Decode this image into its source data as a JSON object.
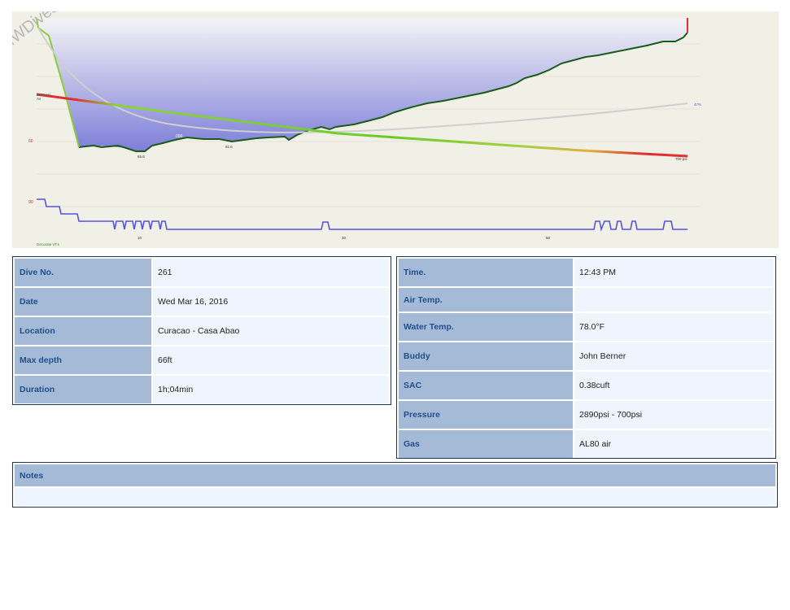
{
  "profile": {
    "watermark": "MWDives.com",
    "start_pressure_label": "2890 psi",
    "start_gas_label": "Air",
    "depth_label_60": "60",
    "depth_label_90": "90",
    "max_depth_marker": "65.6",
    "point_marker_1": "61.6",
    "point_marker_2": "000",
    "end_pressure_label": "700 psi",
    "right_axis_label": "47%",
    "deco_model_label": "Decorate VT4",
    "time_tick_1": "10",
    "time_tick_2": "30",
    "time_tick_3": "50",
    "colors": {
      "background": "#f1f0e6",
      "depth_fill": "#7d7ed8",
      "depth_line": "#1a5a1a",
      "pressure_high": "#e23030",
      "pressure_mid": "#6bcc2c",
      "ascent_line": "#5454e0",
      "gf_line": "#cfcfcf"
    }
  },
  "details_left": {
    "dive_no_label": "Dive No.",
    "dive_no_value": "261",
    "date_label": "Date",
    "date_value": "Wed Mar 16, 2016",
    "location_label": "Location",
    "location_value": "Curacao - Casa Abao",
    "max_depth_label": "Max depth",
    "max_depth_value": "66ft",
    "duration_label": "Duration",
    "duration_value": "1h;04min"
  },
  "details_right": {
    "time_label": "Time.",
    "time_value": "12:43 PM",
    "air_temp_label": "Air Temp.",
    "air_temp_value": "",
    "water_temp_label": "Water Temp.",
    "water_temp_value": "78.0°F",
    "buddy_label": "Buddy",
    "buddy_value": "John Berner",
    "sac_label": "SAC",
    "sac_value": "0.38cuft",
    "pressure_label": "Pressure",
    "pressure_value": "2890psi - 700psi",
    "gas_label": "Gas",
    "gas_value": "AL80 air"
  },
  "notes": {
    "label": "Notes",
    "text": ""
  }
}
